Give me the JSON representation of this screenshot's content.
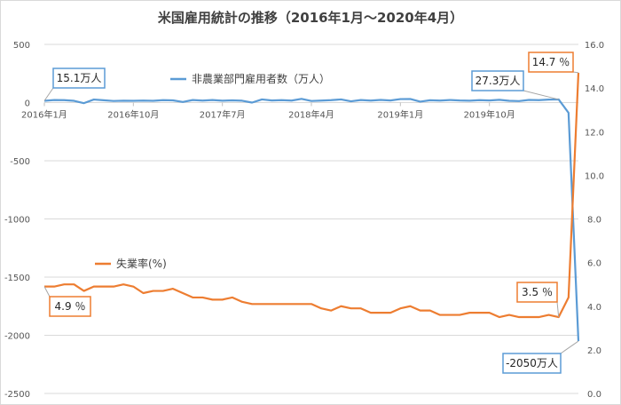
{
  "chart_data": {
    "type": "line",
    "title": "米国雇用統計の推移（2016年1月～2020年4月）",
    "x_tick_labels": [
      "2016年1月",
      "2016年10月",
      "2017年7月",
      "2018年4月",
      "2019年1月",
      "2019年10月"
    ],
    "y_left_ticks": [
      "500",
      "0",
      "-500",
      "-1000",
      "-1500",
      "-2000",
      "-2500"
    ],
    "y_right_ticks": [
      "16.0",
      "14.0",
      "12.0",
      "10.0",
      "8.0",
      "6.0",
      "4.0",
      "2.0",
      "0.0"
    ],
    "y_left_range": [
      -2500,
      500
    ],
    "y_right_range": [
      0,
      16
    ],
    "grid": "horizontal",
    "colors": {
      "payrolls": "#5b9bd5",
      "unemployment": "#ed7d31",
      "grid": "#d9d9d9"
    },
    "series": [
      {
        "name": "非農業部門雇用者数（万人）",
        "axis": "left",
        "values": [
          15.1,
          22,
          21,
          15,
          -5,
          26,
          20,
          14,
          16,
          15,
          17,
          15,
          21,
          19,
          5,
          22,
          17,
          22,
          16,
          19,
          16,
          0,
          27,
          18,
          21,
          17,
          32,
          14,
          17,
          21,
          27,
          11,
          22,
          17,
          23,
          18,
          30,
          31,
          8,
          20,
          17,
          22,
          18,
          16,
          21,
          18,
          24,
          15,
          13,
          23,
          21,
          26,
          27.3,
          -88,
          -2050
        ]
      },
      {
        "name": "失業率(%)",
        "axis": "right",
        "values": [
          4.9,
          4.9,
          5.0,
          5.0,
          4.7,
          4.9,
          4.9,
          4.9,
          5.0,
          4.9,
          4.6,
          4.7,
          4.7,
          4.8,
          4.6,
          4.4,
          4.4,
          4.3,
          4.3,
          4.4,
          4.2,
          4.1,
          4.1,
          4.1,
          4.1,
          4.1,
          4.1,
          4.1,
          3.9,
          3.8,
          4.0,
          3.9,
          3.9,
          3.7,
          3.7,
          3.7,
          3.9,
          4.0,
          3.8,
          3.8,
          3.6,
          3.6,
          3.6,
          3.7,
          3.7,
          3.7,
          3.5,
          3.6,
          3.5,
          3.5,
          3.5,
          3.6,
          3.5,
          4.4,
          14.7
        ]
      }
    ],
    "annotations": [
      {
        "text": "15.1万人",
        "series": 0,
        "index": 0
      },
      {
        "text": "27.3万人",
        "series": 0,
        "index": 52
      },
      {
        "text": "-2050万人",
        "series": 0,
        "index": 54
      },
      {
        "text": "4.9 ％",
        "series": 1,
        "index": 0
      },
      {
        "text": "3.5 ％",
        "series": 1,
        "index": 52
      },
      {
        "text": "14.7 ％",
        "series": 1,
        "index": 54
      }
    ]
  }
}
